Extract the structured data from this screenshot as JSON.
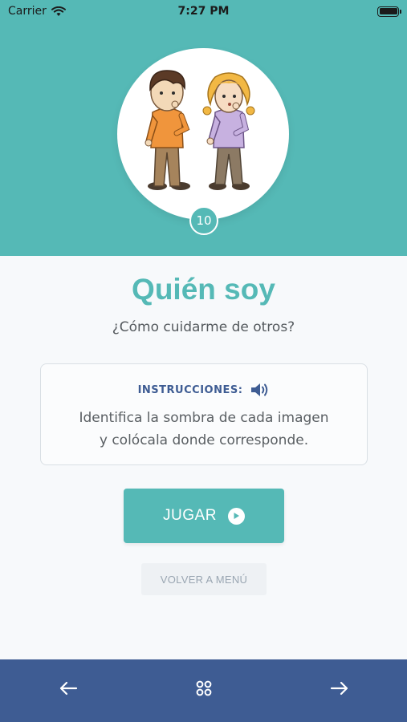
{
  "status_bar": {
    "carrier": "Carrier",
    "time": "7:27 PM"
  },
  "header": {
    "level_number": "10",
    "background_color": "#55b9b6",
    "illustration": "two-children-thinking-illustration"
  },
  "content": {
    "title": "Quién soy",
    "subtitle": "¿Cómo cuidarme de otros?",
    "instructions": {
      "label": "INSTRUCCIONES:",
      "line1": "Identifica la sombra de cada imagen",
      "line2": "y colócala donde corresponde."
    },
    "play_button_label": "JUGAR",
    "menu_button_label": "VOLVER A MENÚ"
  },
  "bottom_nav": {
    "background_color": "#3e5c93",
    "icons": [
      "arrow-left-icon",
      "grid-icon",
      "arrow-right-icon"
    ]
  },
  "colors": {
    "accent": "#55b9b6",
    "navy": "#3e5c93"
  }
}
